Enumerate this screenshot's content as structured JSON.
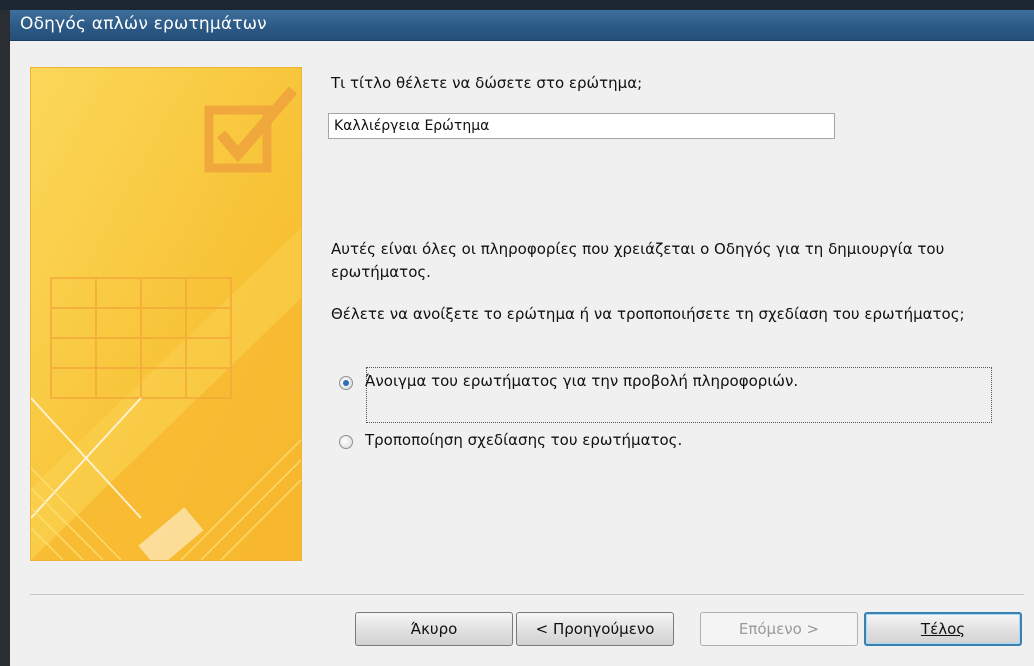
{
  "window": {
    "title": "Οδηγός απλών ερωτημάτων"
  },
  "form": {
    "name_question": "Τι τίτλο θέλετε να δώσετε στο ερώτημα;",
    "name_value": "Καλλιέργεια Ερώτημα",
    "info_text": "Αυτές είναι όλες οι πληροφορίες που χρειάζεται ο Οδηγός για τη δημιουργία του ερωτήματος.",
    "ask_text": "Θέλετε να ανοίξετε το ερώτημα ή να τροποποιήσετε τη σχεδίαση του ερωτήματος;",
    "options": [
      {
        "label": "Άνοιγμα του ερωτήματος για την προβολή πληροφοριών.",
        "checked": true
      },
      {
        "label": "Τροποποίηση σχεδίασης του ερωτήματος.",
        "checked": false
      }
    ]
  },
  "buttons": {
    "cancel": "Άκυρο",
    "back": "< Προηγούμενο",
    "next": "Επόμενο >",
    "finish": "Τέλος"
  },
  "colors": {
    "titlebar": "#2c5a86",
    "banner": "#f9c73a",
    "banner_accent": "#f0a83c",
    "default_button_border": "#3c7fb1"
  },
  "icons": {
    "banner_graphic": "checkbox-check-icon"
  }
}
